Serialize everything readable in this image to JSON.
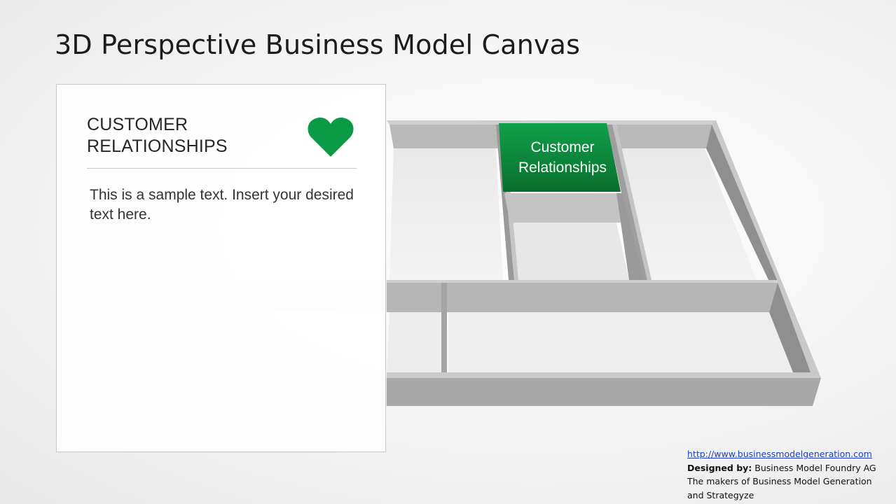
{
  "page": {
    "title": "3D Perspective Business Model Canvas"
  },
  "card": {
    "heading": "CUSTOMER\nRELATIONSHIPS",
    "icon": "heart-icon",
    "body": "This is a sample text. Insert your desired text here.",
    "accent": "#0a9a45"
  },
  "diagram": {
    "highlight_label": "Customer\nRelationships",
    "highlight_color": "#0f8a3c",
    "wall_color": "#b4b4b4",
    "floor_color": "#e6e6e6"
  },
  "credits": {
    "url": "http://www.businessmodelgeneration.com",
    "designed_by_label": "Designed by:",
    "designed_by_value": "Business Model Foundry AG",
    "line3": "The makers of Business Model Generation",
    "line4": "and Strategyze"
  }
}
